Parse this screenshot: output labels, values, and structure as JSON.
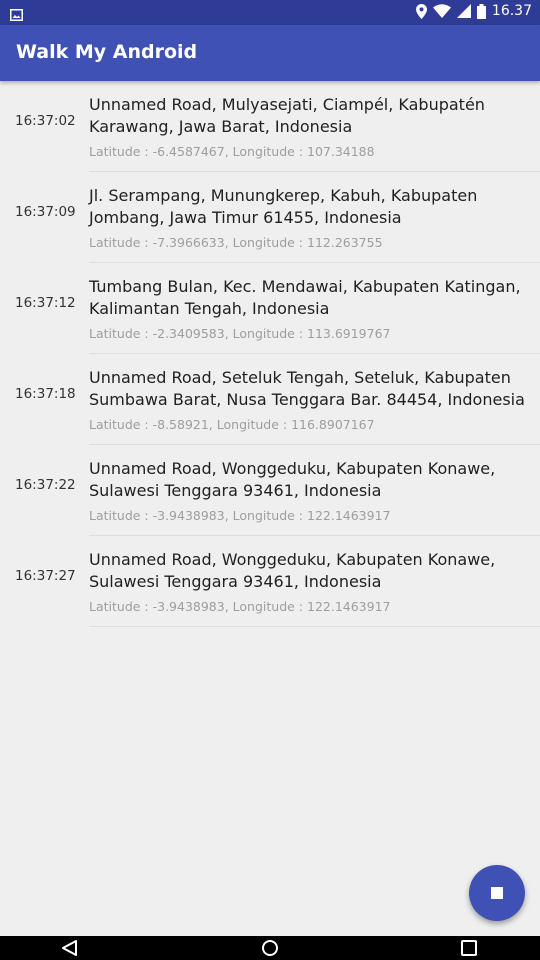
{
  "status_bar": {
    "time": "16.37",
    "left_icon": "image-notification-icon",
    "right_icons": [
      "location-icon",
      "wifi-icon",
      "signal-icon",
      "battery-icon"
    ]
  },
  "app_bar": {
    "title": "Walk My Android"
  },
  "items": [
    {
      "time": "16:37:02",
      "address": "Unnamed Road, Mulyasejati, Ciampél, Kabupatén Karawang, Jawa Barat, Indonesia",
      "coords": "Latitude : -6.4587467, Longitude : 107.34188"
    },
    {
      "time": "16:37:09",
      "address": "Jl. Serampang, Munungkerep, Kabuh, Kabupaten Jombang, Jawa Timur 61455, Indonesia",
      "coords": "Latitude : -7.3966633, Longitude : 112.263755"
    },
    {
      "time": "16:37:12",
      "address": "Tumbang Bulan, Kec. Mendawai, Kabupaten Katingan, Kalimantan Tengah, Indonesia",
      "coords": "Latitude : -2.3409583, Longitude : 113.6919767"
    },
    {
      "time": "16:37:18",
      "address": "Unnamed Road, Seteluk Tengah, Seteluk, Kabupaten Sumbawa Barat, Nusa Tenggara Bar. 84454, Indonesia",
      "coords": "Latitude : -8.58921, Longitude : 116.8907167"
    },
    {
      "time": "16:37:22",
      "address": "Unnamed Road, Wonggeduku, Kabupaten Konawe, Sulawesi Tenggara 93461, Indonesia",
      "coords": "Latitude : -3.9438983, Longitude : 122.1463917"
    },
    {
      "time": "16:37:27",
      "address": "Unnamed Road, Wonggeduku, Kabupaten Konawe, Sulawesi Tenggara 93461, Indonesia",
      "coords": "Latitude : -3.9438983, Longitude : 122.1463917"
    }
  ],
  "fab": {
    "icon": "stop-icon"
  },
  "nav_bar": {
    "icons": [
      "back-icon",
      "home-icon",
      "recents-icon"
    ]
  },
  "colors": {
    "primary": "#3f51b5",
    "primary_dark": "#2f3c97",
    "background": "#efefef",
    "secondary_text": "#9e9e9e"
  }
}
